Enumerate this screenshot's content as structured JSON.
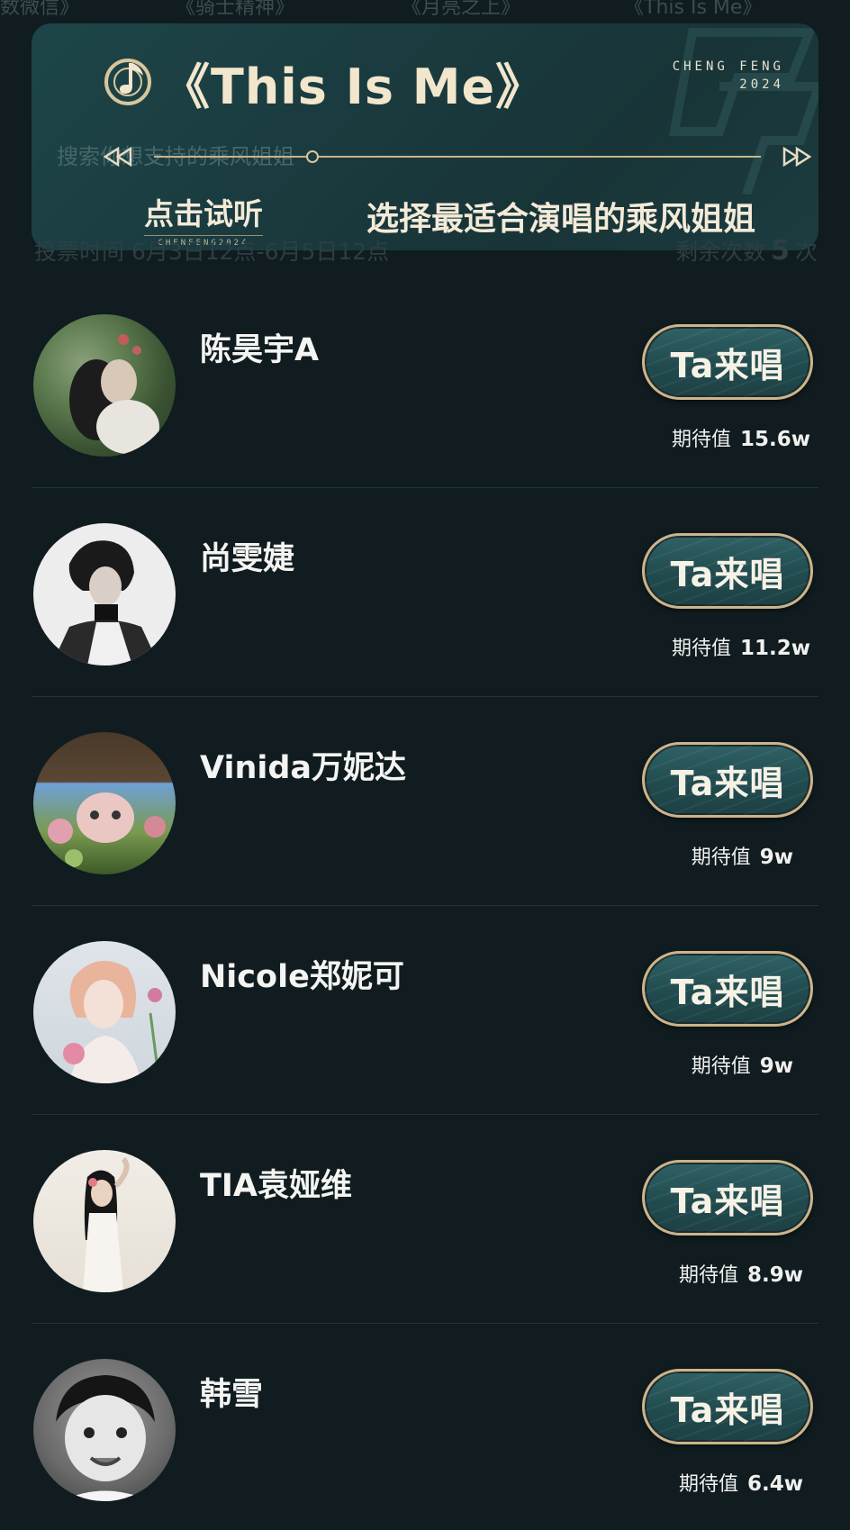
{
  "background_tabs": [
    "数微信》",
    "《骑士精神》",
    "《月亮之上》",
    "《This Is Me》"
  ],
  "banner": {
    "song_title": "《This Is Me》",
    "brand_line1": "CHENG FENG",
    "brand_line2": "2024",
    "listen_label": "点击试听",
    "listen_sub": "CHENFENG2024",
    "subtitle": "选择最适合演唱的乘风姐姐",
    "ghost_search": "搜索你想支持的乘风姐姐"
  },
  "info": {
    "vote_time": "投票时间  6月3日12点-6月5日12点",
    "remaining_label": "剩余次数",
    "remaining_count": "5",
    "remaining_unit": "次"
  },
  "sing_button_label": "Ta来唱",
  "expect_label": "期待值",
  "contestants": [
    {
      "name": "陈昊宇A",
      "expect": "15.6w"
    },
    {
      "name": "尚雯婕",
      "expect": "11.2w"
    },
    {
      "name": "Vinida万妮达",
      "expect": "9w"
    },
    {
      "name": "Nicole郑妮可",
      "expect": "9w"
    },
    {
      "name": "TIA袁娅维",
      "expect": "8.9w"
    },
    {
      "name": "韩雪",
      "expect": "6.4w"
    }
  ],
  "colors": {
    "page_bg": "#101c20",
    "banner_bg": "#1a3b3f",
    "button_fill": "#214b4f",
    "button_border": "#cdb48a",
    "gold_text": "#f2e6cc"
  }
}
